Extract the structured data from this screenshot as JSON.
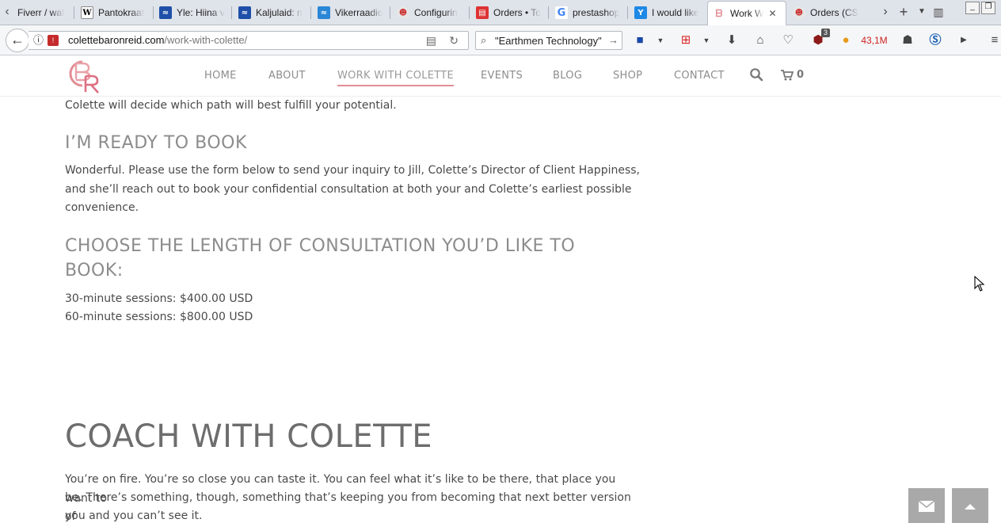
{
  "browser": {
    "tabs": [
      {
        "title": "Fiverr / waf",
        "icon": "fiverr-icon"
      },
      {
        "title": "Pantokraat",
        "icon": "wikipedia-icon"
      },
      {
        "title": "Yle: Hiina v",
        "icon": "err-icon"
      },
      {
        "title": "Kaljulaid: n",
        "icon": "err-icon"
      },
      {
        "title": "Vikerraadio",
        "icon": "err-icon"
      },
      {
        "title": "Configurin",
        "icon": "prestashop-icon"
      },
      {
        "title": "Orders • To",
        "icon": "orders-cart-icon"
      },
      {
        "title": "prestashop",
        "icon": "google-icon"
      },
      {
        "title": "I would like",
        "icon": "yahoo-icon"
      },
      {
        "title": "Work W",
        "icon": "cbr-logo-icon",
        "active": true
      },
      {
        "title": "Orders (CS",
        "icon": "prestashop-icon"
      }
    ],
    "url_domain": "colettebaronreid.com",
    "url_path": "/work-with-colette/",
    "search_value": "\"Earthmen Technology\"",
    "ublock_count": "3",
    "memory_label": "43,1M"
  },
  "site": {
    "menu": [
      {
        "label": "HOME"
      },
      {
        "label": "ABOUT"
      },
      {
        "label": "WORK WITH COLETTE",
        "active": true
      },
      {
        "label": "EVENTS"
      },
      {
        "label": "BLOG"
      },
      {
        "label": "SHOP"
      },
      {
        "label": "CONTACT"
      }
    ],
    "cart_count": "0",
    "accent_color": "#e38d95"
  },
  "content": {
    "intro_line": "Colette will decide which path will best fulfill your potential.",
    "ready_heading": "I’M READY TO BOOK",
    "ready_para_1": "Wonderful. Please use the form below to send your inquiry to Jill, Colette’s Director of Client Happiness,",
    "ready_para_2": "and she’ll reach out to book your confidential consultation at both your and Colette’s earliest possible",
    "ready_para_3": "convenience.",
    "length_heading_1": "CHOOSE THE LENGTH OF CONSULTATION YOU’D LIKE TO",
    "length_heading_2": "BOOK:",
    "price_30": "30-minute sessions: $400.00 USD",
    "price_60": "60-minute sessions: $800.00 USD",
    "coach_heading": "COACH WITH COLETTE",
    "coach_para_1": "You’re on fire. You’re so close you can taste it. You can feel what it’s like to be there, that place you want to",
    "coach_para_2": "be. There’s something, though, something that’s keeping you from becoming that next better version of",
    "coach_para_3": "you and you can’t see it."
  }
}
